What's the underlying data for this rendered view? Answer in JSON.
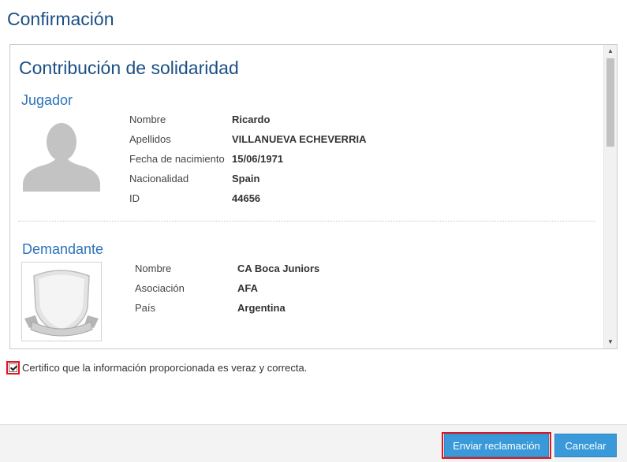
{
  "dialog": {
    "title": "Confirmación"
  },
  "panel": {
    "title": "Contribución de solidaridad",
    "player": {
      "section_title": "Jugador",
      "fields": [
        {
          "label": "Nombre",
          "value": "Ricardo"
        },
        {
          "label": "Apellidos",
          "value": "VILLANUEVA ECHEVERRIA"
        },
        {
          "label": "Fecha de nacimiento",
          "value": "15/06/1971"
        },
        {
          "label": "Nacionalidad",
          "value": "Spain"
        },
        {
          "label": "ID",
          "value": "44656"
        }
      ]
    },
    "claimant": {
      "section_title": "Demandante",
      "fields": [
        {
          "label": "Nombre",
          "value": "CA Boca Juniors"
        },
        {
          "label": "Asociación",
          "value": "AFA"
        },
        {
          "label": "País",
          "value": "Argentina"
        }
      ]
    }
  },
  "certify": {
    "text": "Certifico que la información proporcionada es veraz y correcta.",
    "checked": true
  },
  "buttons": {
    "submit": "Enviar reclamación",
    "cancel": "Cancelar"
  },
  "colors": {
    "accent": "#3a9ad9",
    "title": "#1b4f85",
    "highlight": "#e2141d"
  }
}
